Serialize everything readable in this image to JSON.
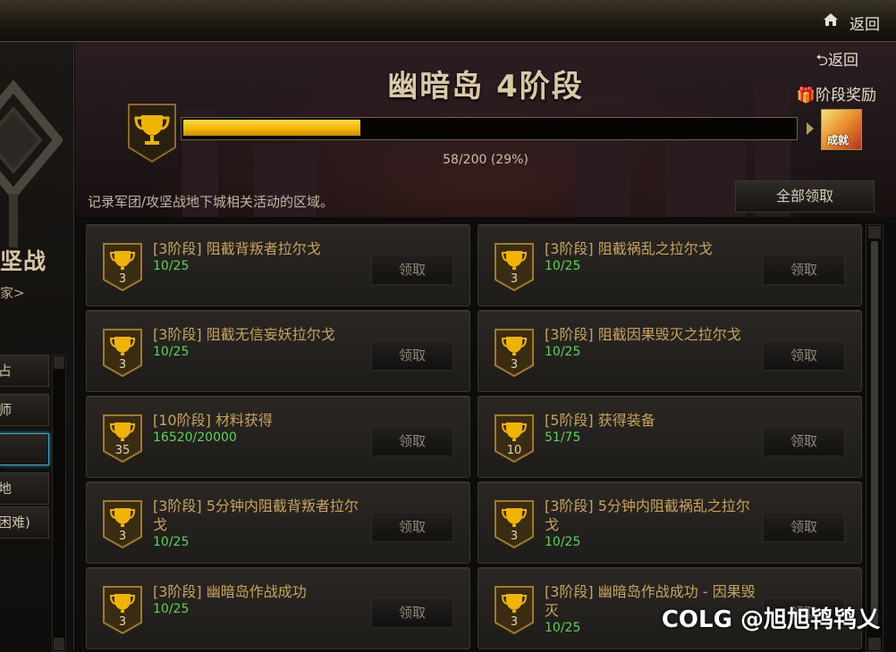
{
  "topbar": {
    "back_label": "返回"
  },
  "left": {
    "title_partial": "坚战",
    "subtitle_partial": "家>",
    "buttons": [
      "占",
      "师",
      "",
      "地",
      "困难)"
    ]
  },
  "header": {
    "title": "幽暗岛 4阶段",
    "sub_back_label": "⮌返回",
    "stage_reward_label": "阶段奖励",
    "reward_icon_text": "成就",
    "progress_text": "58/200 (29%)",
    "progress_fraction": 0.29,
    "description": "记录军团/攻坚战地下城相关活动的区域。",
    "claim_all_label": "全部领取"
  },
  "cards": [
    {
      "badge": "3",
      "title": "[3阶段] 阻截背叛者拉尔戈",
      "progress": "10/25",
      "button": "领取"
    },
    {
      "badge": "3",
      "title": "[3阶段] 阻截祸乱之拉尔戈",
      "progress": "10/25",
      "button": "领取"
    },
    {
      "badge": "3",
      "title": "[3阶段] 阻截无信妄妖拉尔戈",
      "progress": "10/25",
      "button": "领取"
    },
    {
      "badge": "3",
      "title": "[3阶段] 阻截因果毁灭之拉尔戈",
      "progress": "10/25",
      "button": "领取"
    },
    {
      "badge": "35",
      "title": "[10阶段] 材料获得",
      "progress": "16520/20000",
      "button": "领取"
    },
    {
      "badge": "10",
      "title": "[5阶段] 获得装备",
      "progress": "51/75",
      "button": "领取"
    },
    {
      "badge": "3",
      "title": "[3阶段] 5分钟内阻截背叛者拉尔戈",
      "progress": "10/25",
      "button": "领取"
    },
    {
      "badge": "3",
      "title": "[3阶段] 5分钟内阻截祸乱之拉尔戈",
      "progress": "10/25",
      "button": "领取"
    },
    {
      "badge": "3",
      "title": "[3阶段] 幽暗岛作战成功",
      "progress": "10/25",
      "button": "领取"
    },
    {
      "badge": "3",
      "title": "[3阶段] 幽暗岛作战成功 - 因果毁灭",
      "progress": "10/25",
      "button": "领取"
    }
  ],
  "watermark": "COLG @旭旭鸨鸨乂",
  "colors": {
    "accent_gold": "#f0b400",
    "progress_green": "#5bd35c",
    "title_gold": "#c8a35c"
  }
}
